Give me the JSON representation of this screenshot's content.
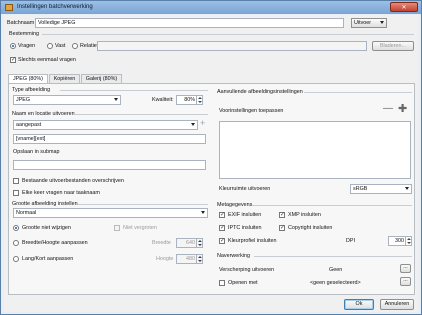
{
  "window": {
    "title": "Instellingen batchverwerking",
    "close_glyph": "✕"
  },
  "top": {
    "batchnaam_label": "Batchnaam",
    "batchnaam_value": "Volledige JPEG",
    "uitvoer_label": "Uitvoer",
    "bestemming_label": "Bestemming",
    "radio_vragen": "Vragen",
    "radio_vast": "Vast",
    "radio_relatief": "Relatief",
    "bladeren_label": "Bladeren...",
    "slechts_label": "Slechts eenmaal vragen"
  },
  "tabs": [
    "JPEG (80%)",
    "Kopiëren",
    "Galerij (80%)"
  ],
  "left": {
    "type_header": "Type afbeelding",
    "type_value": "JPEG",
    "kwaliteit_label": "Kwaliteit:",
    "kwaliteit_value": "80%",
    "naam_header": "Naam en locatie uitvoeren",
    "naam_value": "aangepast",
    "pattern_value": "[vname][ext]",
    "opslaan_label": "Opslaan in submap",
    "overschrijven_label": "Bestaande uitvoerbestanden overschrijven",
    "elke_keer_label": "Elke keer vragen naar taaknaam",
    "grootte_header": "Grootte afbeelding instellen",
    "grootte_value": "Normaal",
    "niet_wijzigen_label": "Grootte niet wijzigen",
    "niet_vergroten_label": "Niet vergroten",
    "breedte_hoogte_label": "Breedte/Hoogte aanpassen",
    "breedte_label": "Breedte",
    "breedte_value": "640",
    "lang_kort_label": "Lang/Kort aanpassen",
    "hoogte_label": "Hoogte",
    "hoogte_value": "480"
  },
  "right": {
    "aanvullende_header": "Aanvullende afbeeldingsinstellingen",
    "voorinstellingen_label": "Voorinstellingen toepassen",
    "minus_glyph": "—",
    "plus_glyph": "✚",
    "kleurruimte_label": "Kleurruimte uitvoeren",
    "kleurruimte_value": "sRGB",
    "metagegevens_header": "Metagegevens",
    "exif_label": "EXIF insluiten",
    "xmp_label": "XMP insluiten",
    "iptc_label": "IPTC insluiten",
    "copyright_label": "Copyright insluiten",
    "kleurprofiel_label": "Kleurprofiel insluiten",
    "dpi_label": "DPI",
    "dpi_value": "300",
    "naverwerking_header": "Naverwerking",
    "versch_label": "Verscherping uitvoeren",
    "versch_value": "Geen",
    "openen_label": "Openen met",
    "openen_value": "<geen geselecteerd>",
    "dots": "..."
  },
  "footer": {
    "ok_label": "Ok",
    "annuleren_label": "Annuleren"
  }
}
